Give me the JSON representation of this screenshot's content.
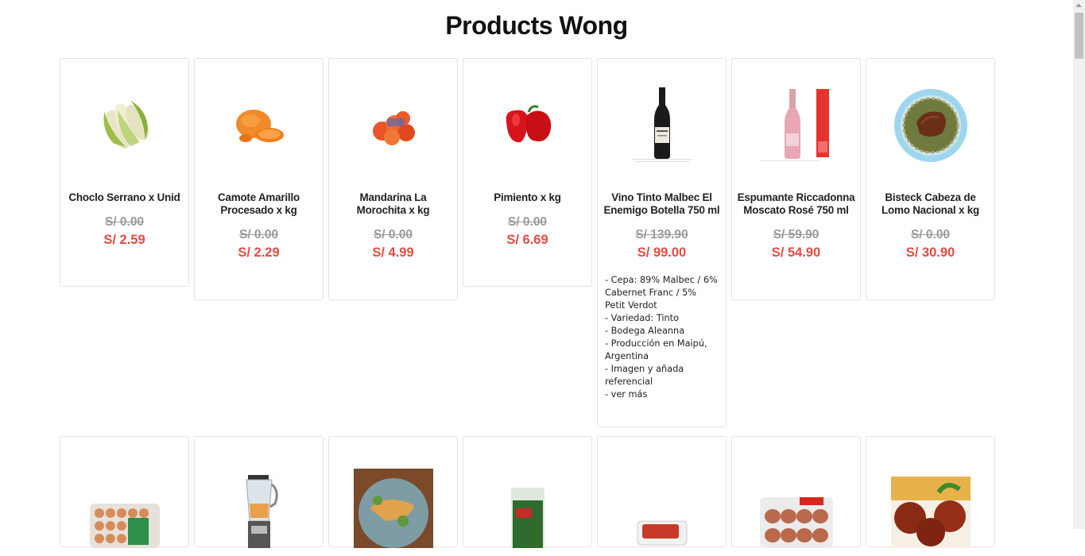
{
  "page": {
    "title": "Products Wong"
  },
  "row1": [
    {
      "name": "Choclo Serrano x Unid",
      "old_price": "S/ 0.00",
      "price": "S/ 2.59",
      "icon": "corn-image"
    },
    {
      "name": "Camote Amarillo Procesado x kg",
      "old_price": "S/ 0.00",
      "price": "S/ 2.29",
      "icon": "sweet-potato-image"
    },
    {
      "name": "Mandarina La Morochita x kg",
      "old_price": "S/ 0.00",
      "price": "S/ 4.99",
      "icon": "tangerine-image"
    },
    {
      "name": "Pimiento x kg",
      "old_price": "S/ 0.00",
      "price": "S/ 6.69",
      "icon": "bell-pepper-image"
    },
    {
      "name": "Vino Tinto Malbec El Enemigo Botella 750 ml",
      "old_price": "S/ 139.90",
      "price": "S/ 99.00",
      "icon": "wine-bottle-image",
      "description": [
        "- Cepa: 89% Malbec / 6% Cabernet Franc / 5% Petit Verdot",
        "- Variedad: Tinto",
        "- Bodega Aleanna",
        "- Producción en Maipú, Argentina",
        "- Imagen y añada referencial",
        "- ver más"
      ]
    },
    {
      "name": "Espumante Riccadonna Moscato Rosé 750 ml",
      "old_price": "S/ 59.90",
      "price": "S/ 54.90",
      "icon": "sparkling-wine-image"
    },
    {
      "name": "Bisteck Cabeza de Lomo Nacional x kg",
      "old_price": "S/ 0.00",
      "price": "S/ 30.90",
      "icon": "steak-plate-image"
    }
  ],
  "row2": [
    {
      "icon": "eggs-tray-image"
    },
    {
      "icon": "blender-image"
    },
    {
      "icon": "chicken-dish-image"
    },
    {
      "icon": "spinach-bag-image"
    },
    {
      "icon": "meat-tray-image"
    },
    {
      "icon": "sausages-pack-image"
    },
    {
      "icon": "meatballs-image"
    }
  ],
  "colors": {
    "sale_price": "#e34b43",
    "old_price": "#9a9a9a",
    "card_border": "#e3e3e3"
  }
}
